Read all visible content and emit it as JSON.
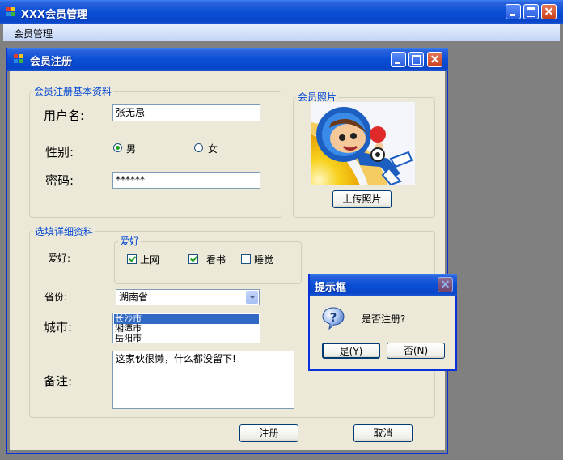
{
  "main_window": {
    "title": "XXX会员管理",
    "menu": [
      "会员管理"
    ]
  },
  "register_window": {
    "title": "会员注册",
    "basic_group": {
      "title": "会员注册基本资料",
      "username_label": "用户名:",
      "username_value": "张无忌",
      "gender_label": "性别:",
      "gender_options": [
        {
          "label": "男",
          "selected": true
        },
        {
          "label": "女",
          "selected": false
        }
      ],
      "password_label": "密码:",
      "password_value": "******"
    },
    "photo_group": {
      "title": "会员照片",
      "upload_button": "上传照片"
    },
    "detail_group": {
      "title": "选填详细资料",
      "hobby_label": "爱好:",
      "hobby_box_title": "爱好",
      "hobbies": [
        {
          "label": "上网",
          "checked": true
        },
        {
          "label": "看书",
          "checked": true
        },
        {
          "label": "睡觉",
          "checked": false
        }
      ],
      "province_label": "省份:",
      "province_value": "湖南省",
      "city_label": "城市:",
      "cities": [
        {
          "label": "长沙市",
          "selected": true
        },
        {
          "label": "湘潭市",
          "selected": false
        },
        {
          "label": "岳阳市",
          "selected": false
        }
      ],
      "remark_label": "备注:",
      "remark_value": "这家伙很懒，什么都没留下!"
    },
    "register_button": "注册",
    "cancel_button": "取消"
  },
  "dialog": {
    "title": "提示框",
    "message": "是否注册?",
    "yes_button": "是(Y)",
    "no_button": "否(N)"
  },
  "colors": {
    "titlebar": "#0a4fd6",
    "form_bg": "#ece9d8",
    "group_title": "#0046d5",
    "selection": "#316ac5"
  }
}
